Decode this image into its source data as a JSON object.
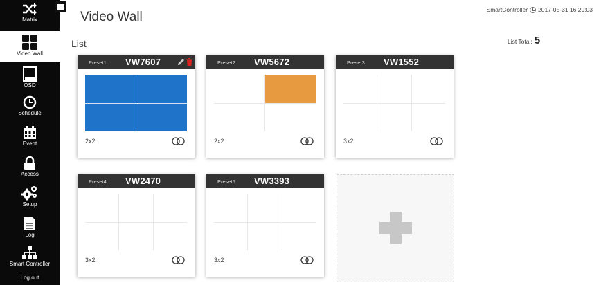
{
  "sidebar": {
    "items": [
      {
        "label": "Matrix",
        "icon": "shuffle-icon"
      },
      {
        "label": "Video Wall",
        "icon": "grid-icon"
      },
      {
        "label": "OSD",
        "icon": "monitor-icon"
      },
      {
        "label": "Schedule",
        "icon": "clock-icon"
      },
      {
        "label": "Event",
        "icon": "calendar-icon"
      },
      {
        "label": "Access",
        "icon": "lock-icon"
      },
      {
        "label": "Setup",
        "icon": "gears-icon"
      },
      {
        "label": "Log",
        "icon": "document-icon"
      },
      {
        "label": "Smart Controller",
        "icon": "sitemap-icon"
      }
    ],
    "logout_label": "Log out"
  },
  "header": {
    "title": "Video Wall",
    "controller_name": "SmartController",
    "datetime": "2017-05-31 16:29:03"
  },
  "list": {
    "title": "List",
    "total_label": "List Total:",
    "total_value": "5"
  },
  "cards": [
    {
      "preset": "Preset1",
      "name": "VW7607",
      "layout": "2x2",
      "cols": 2,
      "rows": 2,
      "filled_cells": [
        0,
        1,
        2,
        3
      ],
      "fill_color": "#1f73c9",
      "show_actions": true
    },
    {
      "preset": "Preset2",
      "name": "VW5672",
      "layout": "2x2",
      "cols": 2,
      "rows": 2,
      "filled_cells": [
        1
      ],
      "fill_color": "#e79a3f",
      "show_actions": false
    },
    {
      "preset": "Preset3",
      "name": "VW1552",
      "layout": "3x2",
      "cols": 3,
      "rows": 2,
      "filled_cells": [],
      "fill_color": "",
      "show_actions": false
    },
    {
      "preset": "Preset4",
      "name": "VW2470",
      "layout": "3x2",
      "cols": 3,
      "rows": 2,
      "filled_cells": [],
      "fill_color": "",
      "show_actions": false
    },
    {
      "preset": "Preset5",
      "name": "VW3393",
      "layout": "3x2",
      "cols": 3,
      "rows": 2,
      "filled_cells": [],
      "fill_color": "",
      "show_actions": false
    }
  ],
  "colors": {
    "sidebar_bg": "#0a0a0a",
    "card_header_bg": "#333333",
    "edit_icon": "#cccccc",
    "delete_icon": "#d9241d"
  }
}
